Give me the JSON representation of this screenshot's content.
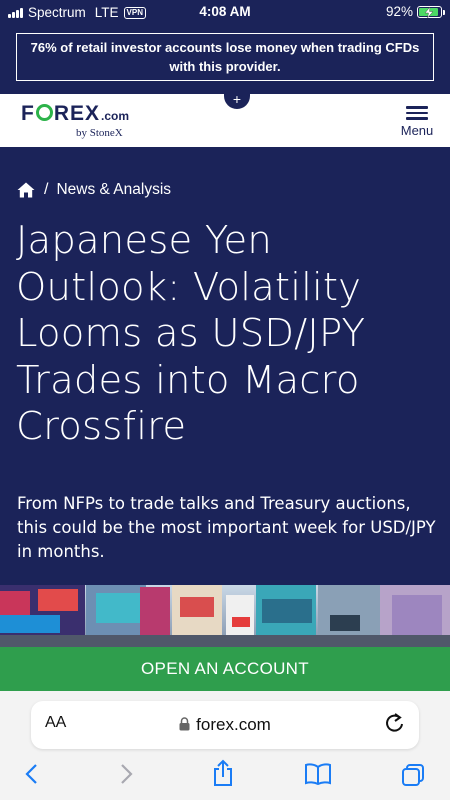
{
  "status_bar": {
    "carrier": "Spectrum",
    "network": "LTE",
    "vpn": "VPN",
    "time": "4:08 AM",
    "battery": "92%",
    "battery_level": 0.92
  },
  "risk_warning": "76% of retail investor accounts lose money when trading CFDs with this provider.",
  "header": {
    "logo_fx": "F",
    "logo_rex": "REX",
    "logo_dotcom": ".com",
    "logo_sub": "by StoneX",
    "plus": "+",
    "menu_label": "Menu"
  },
  "breadcrumb": {
    "separator": "/",
    "section": "News & Analysis"
  },
  "article": {
    "title": "Japanese Yen Outlook: Volatility Looms as USD/JPY Trades into Macro Crossfire",
    "subtitle": "From NFPs to trade talks and Treasury auctions, this could be the most important week for USD/JPY in months."
  },
  "cta": {
    "label": "OPEN AN ACCOUNT"
  },
  "browser": {
    "aa_label": "AA",
    "url": "forex.com"
  },
  "colors": {
    "navy": "#1b2359",
    "green": "#2f9e4d",
    "ios_blue": "#1a7cf5"
  }
}
